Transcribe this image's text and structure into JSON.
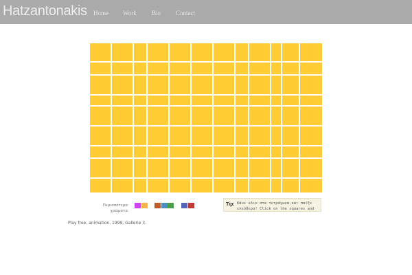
{
  "header": {
    "brand": "Hatzantonakis",
    "nav": [
      {
        "label": "Home"
      },
      {
        "label": "Work"
      },
      {
        "label": "Bio"
      },
      {
        "label": "Contact"
      }
    ]
  },
  "grid": {
    "columns": 12,
    "rows": 9,
    "cell_color": "#ffcc33",
    "gap_color": "#ffffff"
  },
  "palette": {
    "label": "Περισσότερα χρώματα",
    "swatches": [
      "#cc44ee",
      "#f5b34a",
      "#c45a26",
      "#4c8ec4",
      "#4aa04a",
      "#5566b8",
      "#c03a3a"
    ]
  },
  "tip": {
    "label": "Tip:",
    "text": "Κάνε κλικ στα τετράγωνα,και παίξε ελεύθερα! Click on the squares and play freely!"
  },
  "caption": "Play free, animation, 1999, Gallerie 3."
}
